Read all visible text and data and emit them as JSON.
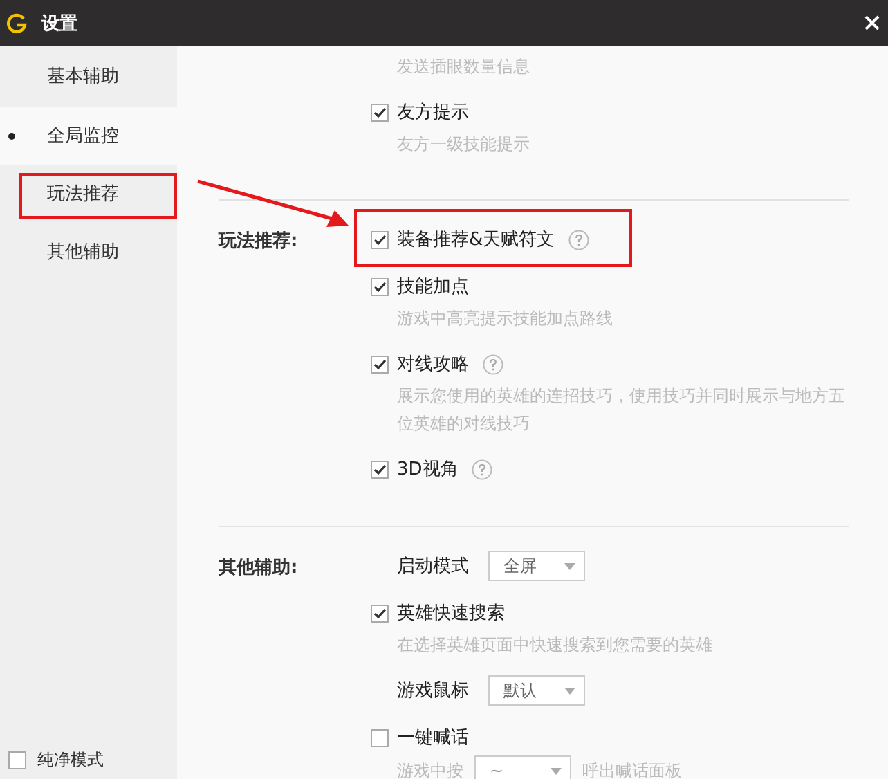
{
  "window": {
    "title": "设置"
  },
  "sidebar": {
    "items": [
      {
        "label": "基本辅助",
        "selected": false
      },
      {
        "label": "全局监控",
        "selected": true
      },
      {
        "label": "玩法推荐",
        "selected": false
      },
      {
        "label": "其他辅助",
        "selected": false
      }
    ],
    "footer": {
      "label": "纯净模式",
      "checked": false
    }
  },
  "sections": [
    {
      "items": [
        {
          "kind": "note",
          "text": "发送插眼数量信息"
        },
        {
          "kind": "checkbox",
          "label": "友方提示",
          "checked": true,
          "help": false,
          "description": "友方一级技能提示"
        }
      ]
    },
    {
      "label": "玩法推荐:",
      "items": [
        {
          "kind": "checkbox",
          "label": "装备推荐&天赋符文",
          "checked": true,
          "help": true
        },
        {
          "kind": "checkbox",
          "label": "技能加点",
          "checked": true,
          "help": false,
          "description": "游戏中高亮提示技能加点路线"
        },
        {
          "kind": "checkbox",
          "label": "对线攻略",
          "checked": true,
          "help": true,
          "description": "展示您使用的英雄的连招技巧，使用技巧并同时展示与地方五位英雄的对线技巧"
        },
        {
          "kind": "checkbox",
          "label": "3D视角",
          "checked": true,
          "help": true
        }
      ]
    },
    {
      "label": "其他辅助:",
      "items": [
        {
          "kind": "select",
          "label": "启动模式",
          "value": "全屏"
        },
        {
          "kind": "checkbox",
          "label": "英雄快速搜索",
          "checked": true,
          "help": false,
          "description": "在选择英雄页面中快速搜索到您需要的英雄"
        },
        {
          "kind": "select",
          "label": "游戏鼠标",
          "value": "默认"
        },
        {
          "kind": "checkbox",
          "label": "一键喊话",
          "checked": false,
          "help": false
        },
        {
          "kind": "inline-select",
          "prefix": "游戏中按",
          "value": "~",
          "suffix": "呼出喊话面板"
        }
      ]
    }
  ]
}
